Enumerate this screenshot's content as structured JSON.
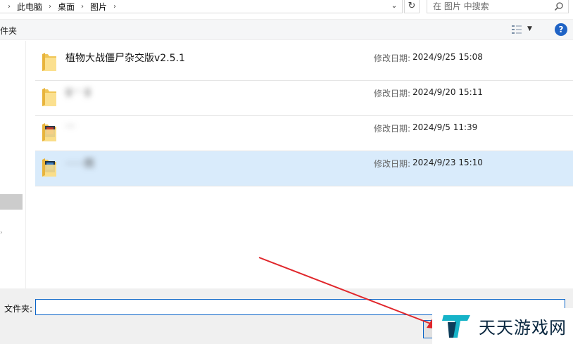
{
  "address_bar": {
    "breadcrumbs": [
      "此电脑",
      "桌面",
      "图片"
    ]
  },
  "search": {
    "placeholder": "在 图片 中搜索"
  },
  "toolbar": {
    "new_folder_label": "件夹",
    "help_label": "?"
  },
  "files": [
    {
      "name": "植物大战僵尸杂交版v2.5.1",
      "modified_label": "修改日期:",
      "modified": "2024/9/25 15:08",
      "icon": "folder-icon",
      "blurred": false,
      "selected": false
    },
    {
      "name": "g··· g",
      "modified_label": "修改日期:",
      "modified": "2024/9/20 15:11",
      "icon": "folder-icon",
      "blurred": true,
      "selected": false
    },
    {
      "name": "···",
      "modified_label": "修改日期:",
      "modified": "2024/9/5 11:39",
      "icon": "folder-with-pictures-icon",
      "blurred": true,
      "selected": false
    },
    {
      "name": "······图",
      "modified_label": "修改日期:",
      "modified": "2024/9/23 15:10",
      "icon": "folder-with-pictures-icon",
      "blurred": true,
      "selected": true
    }
  ],
  "bottom": {
    "folder_label": "文件夹:",
    "folder_value": ""
  },
  "watermark": {
    "text": "天天游戏网"
  },
  "colors": {
    "accent": "#0a64c7",
    "selected_row": "#d9ebfb",
    "annotation": "#e0262b",
    "help": "#1f63c5"
  }
}
